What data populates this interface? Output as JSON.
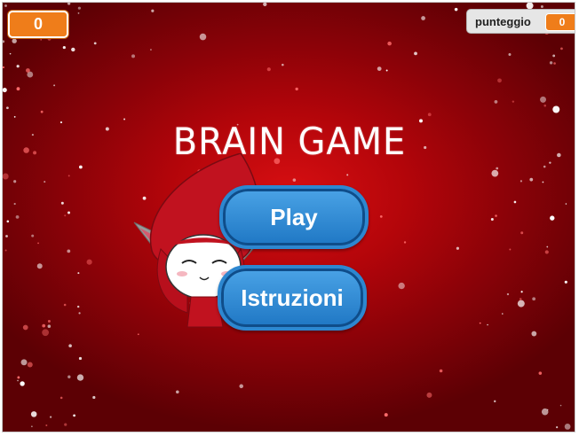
{
  "stage": {
    "background_colors": {
      "center": "#d80f12",
      "edge": "#5c0004"
    }
  },
  "monitors": {
    "left_value": "0",
    "score_label": "punteggio",
    "score_value": "0",
    "accent": "#ef7d1a"
  },
  "title": "BRAIN GAME",
  "buttons": {
    "play_label": "Play",
    "istruzioni_label": "Istruzioni",
    "color": "#2d87d0"
  },
  "mascot": {
    "icon": "red-elf-character-icon"
  }
}
